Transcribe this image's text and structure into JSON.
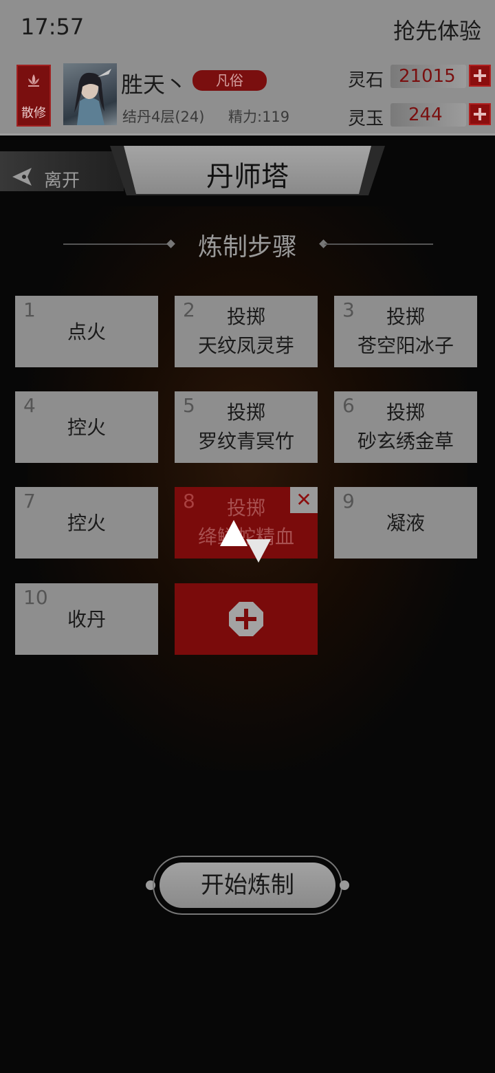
{
  "status_bar": {
    "time": "17:57",
    "right_text": "抢先体验"
  },
  "player": {
    "sect_label": "散修",
    "name": "胜天丶",
    "rank": "凡俗",
    "realm": "结丹4层(24)",
    "energy": "精力:119"
  },
  "currencies": [
    {
      "label": "灵石",
      "value": "21015"
    },
    {
      "label": "灵玉",
      "value": "244"
    }
  ],
  "nav": {
    "back_label": "离开",
    "title": "丹师塔"
  },
  "section_title": "炼制步骤",
  "steps": [
    {
      "num": "1",
      "line1": "点火",
      "line2": ""
    },
    {
      "num": "2",
      "line1": "投掷",
      "line2": "天纹凤灵芽"
    },
    {
      "num": "3",
      "line1": "投掷",
      "line2": "苍空阳冰子"
    },
    {
      "num": "4",
      "line1": "控火",
      "line2": ""
    },
    {
      "num": "5",
      "line1": "投掷",
      "line2": "罗纹青冥竹"
    },
    {
      "num": "6",
      "line1": "投掷",
      "line2": "砂玄绣金草"
    },
    {
      "num": "7",
      "line1": "控火",
      "line2": ""
    },
    {
      "num": "8",
      "line1": "投掷",
      "line2": "绛鳞蛇精血"
    },
    {
      "num": "9",
      "line1": "凝液",
      "line2": ""
    },
    {
      "num": "10",
      "line1": "收丹",
      "line2": ""
    }
  ],
  "remove_symbol": "✕",
  "start_button": "开始炼制",
  "colors": {
    "accent_red": "#7a0b0b",
    "card_gray": "#8e8e8e",
    "background": "#070707"
  },
  "icons": [
    "lotus-icon",
    "back-arrow-icon",
    "plus-icon",
    "close-icon",
    "drag-up-arrow-icon",
    "drag-down-arrow-icon"
  ]
}
